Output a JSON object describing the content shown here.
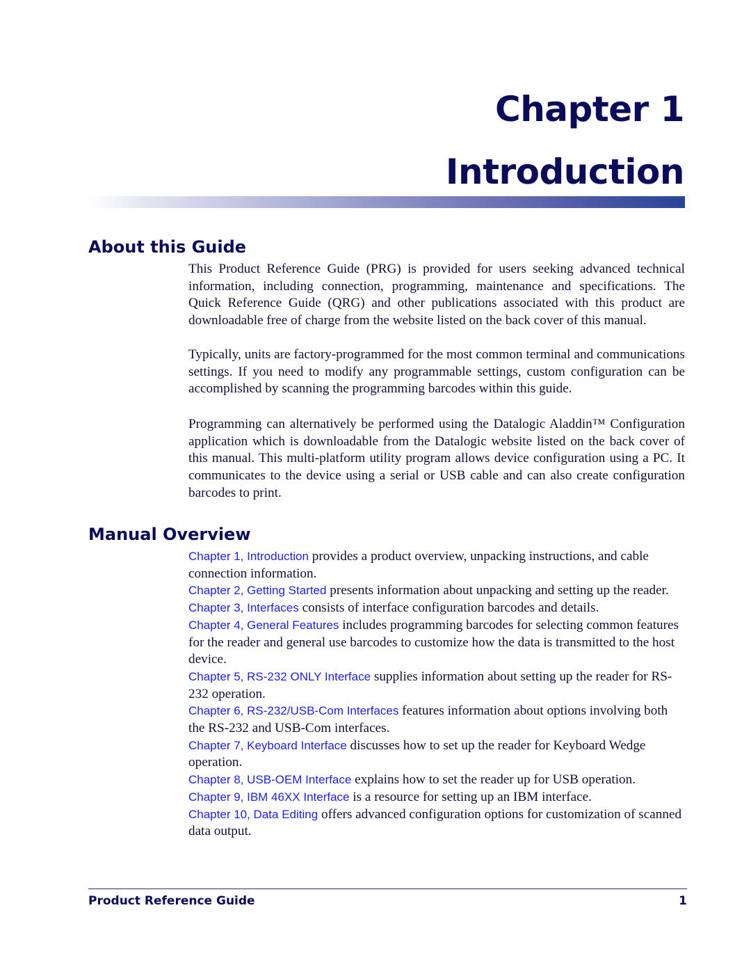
{
  "chapter": {
    "number_label": "Chapter 1",
    "title": "Introduction",
    "colors": {
      "heading": "#0b0b5c",
      "bar_end": "#2a4596"
    }
  },
  "about": {
    "heading": "About this Guide",
    "paragraphs": [
      "This Product Reference Guide (PRG) is provided for users seeking advanced technical information, including connection, programming, maintenance and specifications. The Quick Reference Guide (QRG) and other publications associated with this product are downloadable free of charge from the website listed on the back cover of this manual.",
      "Typically, units are factory-programmed for the most common terminal and communi­cations settings. If you need to modify any programmable settings, custom configuration can be accomplished by scanning the programming barcodes within this guide.",
      "Programming can alternatively be performed using the Datalogic Aladdin™ Configura­tion application which is downloadable from the Datalogic website listed on the back cover of this manual. This multi-platform utility program allows device configuration us­ing a PC. It communicates to the device using a serial or USB cable and can also create configuration barcodes to print."
    ]
  },
  "overview": {
    "heading": "Manual Overview",
    "link_color": "#1f1fe6",
    "items": [
      {
        "link": "Chapter 1, Introduction",
        "text": " provides a product overview, unpacking instructions, and cable connection information."
      },
      {
        "link": "Chapter 2, Getting Started",
        "text": " presents information about unpacking and setting up the reader."
      },
      {
        "link": "Chapter 3, Interfaces",
        "text": " consists of interface configuration barcodes and details."
      },
      {
        "link": "Chapter 4, General Features",
        "text": " includes programming barcodes for selecting common features for the reader and general use barcodes to customize how the data is transmitted to the host device."
      },
      {
        "link": "Chapter 5, RS-232 ONLY Interface",
        "text": " supplies information about setting up the reader for RS-232 operation."
      },
      {
        "link": "Chapter 6, RS-232/USB-Com Interfaces",
        "text": " features information about options involving both the RS-232 and USB-Com interfaces."
      },
      {
        "link": "Chapter 7, Keyboard Interface",
        "text": " discusses how to set up the reader for Keyboard Wedge operation."
      },
      {
        "link": "Chapter 8, USB-OEM Interface",
        "text": " explains how to set the reader up for USB operation."
      },
      {
        "link": "Chapter 9, IBM 46XX Interface",
        "text": " is a resource for setting up an IBM interface."
      },
      {
        "link": "Chapter 10, Data Editing",
        "text": " offers advanced configuration options for customization of scanned data output."
      }
    ]
  },
  "footer": {
    "title": "Product Reference Guide",
    "page_number": "1"
  }
}
